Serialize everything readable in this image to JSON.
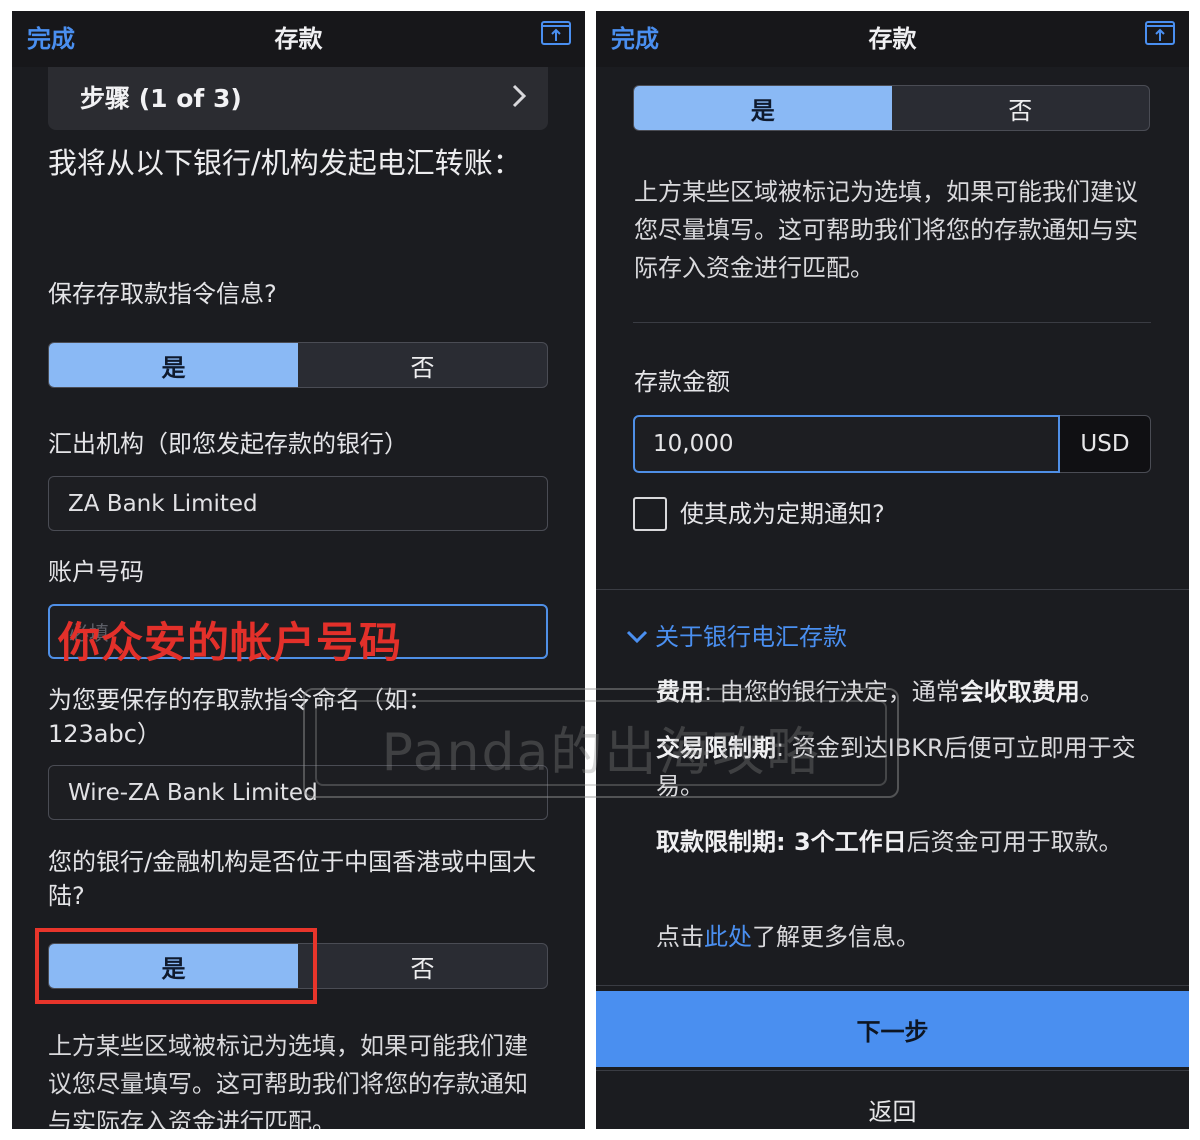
{
  "left": {
    "topbar": {
      "done": "完成",
      "title": "存款"
    },
    "step": {
      "label": "步骤 (1 of 3)"
    },
    "heading": "我将从以下银行/机构发起电汇转账：",
    "save_question": "保存存取款指令信息?",
    "save_toggle": {
      "yes": "是",
      "no": "否"
    },
    "institution_label": "汇出机构（即您发起存款的银行）",
    "institution_value": "ZA Bank Limited",
    "account_label": "账户号码",
    "account_placeholder": "必填",
    "account_overlay": "你众安的帐户号码",
    "name_label": "为您要保存的存取款指令命名（如：123abc）",
    "name_value": "Wire-ZA Bank Limited",
    "location_question": "您的银行/金融机构是否位于中国香港或中国大陆?",
    "location_toggle": {
      "yes": "是",
      "no": "否"
    },
    "note": "上方某些区域被标记为选填，如果可能我们建议您尽量填写。这可帮助我们将您的存款通知与实际存入资金进行匹配。"
  },
  "right": {
    "topbar": {
      "done": "完成",
      "title": "存款"
    },
    "toggle": {
      "yes": "是",
      "no": "否"
    },
    "note": "上方某些区域被标记为选填，如果可能我们建议您尽量填写。这可帮助我们将您的存款通知与实际存入资金进行匹配。",
    "amount_label": "存款金额",
    "amount_value": "10,000",
    "currency": "USD",
    "recurring_label": "使其成为定期通知?",
    "about_title": "关于银行电汇存款",
    "fee_label": "费用",
    "fee_text_1": ": 由您的银行决定，通常",
    "fee_bold": "会收取费用",
    "fee_end": "。",
    "trade_label": "交易限制期",
    "trade_text": ": 资金到达IBKR后便可立即用于交易。",
    "withdraw_label": "取款限制期",
    "withdraw_bold": ": 3个工作日",
    "withdraw_text": "后资金可用于取款。",
    "more_prefix": "点击",
    "more_link": "此处",
    "more_suffix": "了解更多信息。",
    "next_button": "下一步",
    "back_button": "返回"
  },
  "watermark": "Panda的出海攻略",
  "colors": {
    "accent": "#4a8ff0",
    "toggle_active": "#8ab9f5",
    "highlight_red": "#e8352b"
  }
}
